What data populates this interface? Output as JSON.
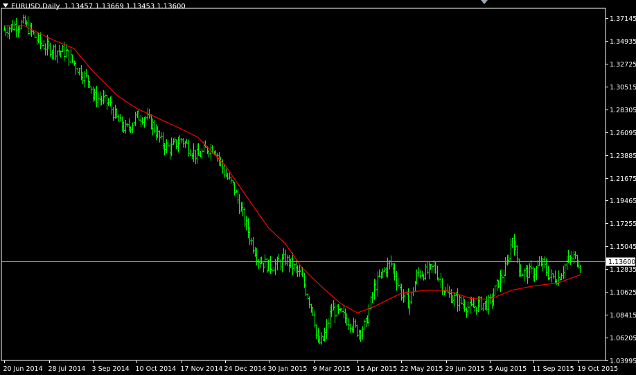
{
  "window": {
    "symbol_label": "EURUSD,Daily",
    "ohlc_text": "1.13457 1.13669 1.13453 1.13600",
    "current_price_label": "1.13600",
    "colors": {
      "background": "#000000",
      "bars": "#00ff00",
      "moving_average": "#ff0000",
      "axis": "#ffffff",
      "bid_line": "#8aa0b4",
      "price_tag_bg": "#ffffff",
      "price_tag_fg": "#000000"
    },
    "icons": [
      "dropdown-triangle-icon",
      "chart-shift-icon"
    ]
  },
  "chart_data": {
    "type": "line",
    "ylim": [
      1.03995,
      1.37145
    ],
    "xlim": [
      "2014-06-20",
      "2015-10-21"
    ],
    "current_price": 1.136,
    "y_ticks": [
      "1.37145",
      "1.34935",
      "1.32725",
      "1.30515",
      "1.28305",
      "1.26095",
      "1.23885",
      "1.21675",
      "1.19465",
      "1.17255",
      "1.15045",
      "1.12835",
      "1.10625",
      "1.08415",
      "1.06205",
      "1.03995"
    ],
    "x_ticks": [
      {
        "date": "2014-06-20",
        "label": "20 Jun 2014"
      },
      {
        "date": "2014-07-28",
        "label": "28 Jul 2014"
      },
      {
        "date": "2014-09-03",
        "label": "3 Sep 2014"
      },
      {
        "date": "2014-10-10",
        "label": "10 Oct 2014"
      },
      {
        "date": "2014-11-17",
        "label": "17 Nov 2014"
      },
      {
        "date": "2014-12-24",
        "label": "24 Dec 2014"
      },
      {
        "date": "2015-01-30",
        "label": "30 Jan 2015"
      },
      {
        "date": "2015-03-09",
        "label": "9 Mar 2015"
      },
      {
        "date": "2015-04-15",
        "label": "15 Apr 2015"
      },
      {
        "date": "2015-05-22",
        "label": "22 May 2015"
      },
      {
        "date": "2015-06-29",
        "label": "29 Jun 2015"
      },
      {
        "date": "2015-08-05",
        "label": "5 Aug 2015"
      },
      {
        "date": "2015-09-11",
        "label": "11 Sep 2015"
      },
      {
        "date": "2015-10-19",
        "label": "19 Oct 2015"
      }
    ],
    "series": [
      {
        "style": "bars",
        "x": [
          "2014-06-20",
          "2014-06-30",
          "2014-07-07",
          "2014-07-14",
          "2014-07-21",
          "2014-07-28",
          "2014-08-04",
          "2014-08-11",
          "2014-08-18",
          "2014-08-25",
          "2014-09-01",
          "2014-09-03",
          "2014-09-10",
          "2014-09-17",
          "2014-09-24",
          "2014-10-01",
          "2014-10-10",
          "2014-10-17",
          "2014-10-24",
          "2014-10-31",
          "2014-11-07",
          "2014-11-17",
          "2014-11-24",
          "2014-12-01",
          "2014-12-08",
          "2014-12-15",
          "2014-12-24",
          "2014-12-31",
          "2015-01-07",
          "2015-01-14",
          "2015-01-21",
          "2015-01-30",
          "2015-02-06",
          "2015-02-13",
          "2015-02-20",
          "2015-02-27",
          "2015-03-09",
          "2015-03-12",
          "2015-03-17",
          "2015-03-24",
          "2015-03-31",
          "2015-04-08",
          "2015-04-15",
          "2015-04-22",
          "2015-04-29",
          "2015-05-06",
          "2015-05-13",
          "2015-05-22",
          "2015-05-29",
          "2015-06-05",
          "2015-06-12",
          "2015-06-19",
          "2015-06-29",
          "2015-07-06",
          "2015-07-13",
          "2015-07-20",
          "2015-07-27",
          "2015-08-05",
          "2015-08-12",
          "2015-08-19",
          "2015-08-24",
          "2015-08-31",
          "2015-09-11",
          "2015-09-18",
          "2015-09-25",
          "2015-10-02",
          "2015-10-09",
          "2015-10-15",
          "2015-10-19",
          "2015-10-21"
        ],
        "values": [
          1.36,
          1.365,
          1.366,
          1.356,
          1.346,
          1.342,
          1.34,
          1.338,
          1.328,
          1.317,
          1.309,
          1.295,
          1.293,
          1.288,
          1.272,
          1.263,
          1.276,
          1.276,
          1.267,
          1.251,
          1.245,
          1.254,
          1.245,
          1.237,
          1.245,
          1.246,
          1.22,
          1.208,
          1.184,
          1.159,
          1.138,
          1.131,
          1.133,
          1.138,
          1.13,
          1.12,
          1.085,
          1.055,
          1.06,
          1.09,
          1.085,
          1.078,
          1.068,
          1.075,
          1.11,
          1.125,
          1.135,
          1.105,
          1.095,
          1.125,
          1.125,
          1.13,
          1.105,
          1.1,
          1.095,
          1.09,
          1.095,
          1.095,
          1.115,
          1.13,
          1.16,
          1.125,
          1.125,
          1.135,
          1.12,
          1.12,
          1.135,
          1.14,
          1.135,
          1.136
        ]
      },
      {
        "style": "line",
        "x": [
          "2014-06-20",
          "2014-07-07",
          "2014-07-28",
          "2014-08-18",
          "2014-09-03",
          "2014-09-24",
          "2014-10-10",
          "2014-10-31",
          "2014-11-17",
          "2014-12-01",
          "2014-12-24",
          "2015-01-14",
          "2015-01-30",
          "2015-02-13",
          "2015-02-27",
          "2015-03-17",
          "2015-04-01",
          "2015-04-15",
          "2015-04-29",
          "2015-05-22",
          "2015-06-12",
          "2015-06-29",
          "2015-07-20",
          "2015-08-05",
          "2015-08-24",
          "2015-09-11",
          "2015-10-02",
          "2015-10-21"
        ],
        "values": [
          1.364,
          1.364,
          1.352,
          1.342,
          1.32,
          1.296,
          1.284,
          1.273,
          1.264,
          1.256,
          1.229,
          1.194,
          1.168,
          1.153,
          1.13,
          1.11,
          1.095,
          1.086,
          1.092,
          1.105,
          1.108,
          1.108,
          1.1,
          1.099,
          1.108,
          1.112,
          1.115,
          1.123
        ]
      }
    ]
  }
}
